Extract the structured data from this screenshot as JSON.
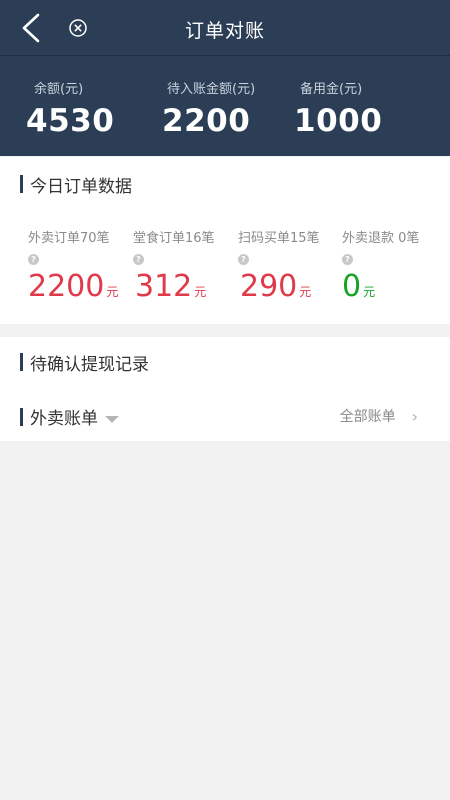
{
  "header": {
    "title": "订单对账",
    "back_icon": "back-arrow-icon",
    "close_icon": "close-circle-icon"
  },
  "summary": {
    "balance_label": "余额(元)",
    "balance_value": "4530",
    "pending_label": "待入账金额(元)",
    "pending_value": "2200",
    "reserve_label": "备用金(元)",
    "reserve_value": "1000"
  },
  "today": {
    "title": "今日订单数据",
    "stats": [
      {
        "label": "外卖订单70笔",
        "value": "2200",
        "unit": "元"
      },
      {
        "label": "堂食订单16笔",
        "value": "312",
        "unit": "元"
      },
      {
        "label": "扫码买单15笔",
        "value": "290",
        "unit": "元"
      },
      {
        "label": "外卖退款  0笔",
        "value": "0",
        "unit": "元"
      }
    ],
    "help_glyph": "?"
  },
  "pending_withdraw": {
    "title": "待确认提现记录",
    "filter_label": "外卖账单",
    "all_bills_label": "全部账单",
    "chevron": "›"
  },
  "colors": {
    "header_bg": "#2b3e55",
    "amount_red": "#e0394a",
    "amount_green": "#17a324"
  }
}
